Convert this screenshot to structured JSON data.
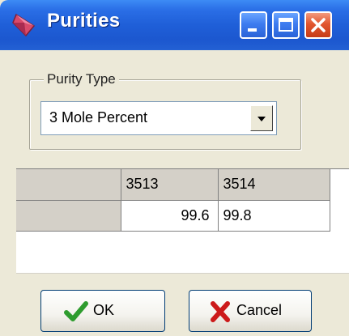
{
  "window": {
    "title": "Purities",
    "title_icon": "diamond-app-icon",
    "controls": [
      "minimize-icon",
      "maximize-icon",
      "close-icon"
    ]
  },
  "purity_type": {
    "label": "Purity Type",
    "selected": "3 Mole Percent",
    "dropdown_icon": "chevron-down-icon"
  },
  "grid": {
    "columns": [
      "3513",
      "3514"
    ],
    "rows": [
      {
        "header": "",
        "values": [
          "99.6",
          "99.8"
        ]
      }
    ]
  },
  "buttons": {
    "ok_label": "OK",
    "ok_icon": "checkmark-icon",
    "cancel_label": "Cancel",
    "cancel_icon": "x-icon"
  },
  "colors": {
    "titlebar": "#1f5fd8",
    "close_button": "#e2562f",
    "ok_check": "#2e9c2e",
    "cancel_x": "#cc1a1a"
  }
}
